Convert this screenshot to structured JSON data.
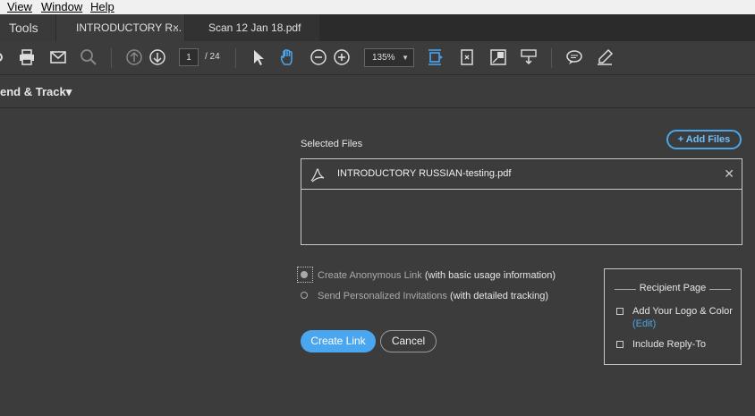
{
  "menubar": {
    "items": [
      "View",
      "Window",
      "Help"
    ]
  },
  "tabs": {
    "tools": "Tools",
    "active": "INTRODUCTORY R...",
    "close_symbol": "×",
    "second": "Scan 12 Jan 18.pdf"
  },
  "toolbar": {
    "page_current": "1",
    "page_total": "/ 24",
    "zoom": "135%",
    "icons": [
      "save-icon",
      "print-icon",
      "email-icon",
      "search-icon",
      "prev-page-icon",
      "next-page-icon",
      "select-cursor-icon",
      "hand-tool-icon",
      "zoom-out-icon",
      "zoom-in-icon",
      "fit-page-icon",
      "rotate-icon",
      "full-screen-icon",
      "scroll-mode-icon",
      "comment-icon",
      "highlight-icon"
    ]
  },
  "section": {
    "title": "end & Track",
    "caret": "▾"
  },
  "files": {
    "label": "Selected Files",
    "add_button": "+ Add Files",
    "items": [
      "INTRODUCTORY RUSSIAN-testing.pdf"
    ],
    "close_symbol": "✕"
  },
  "options": {
    "anonymous": {
      "label": "Create Anonymous Link",
      "hint": "(with basic usage information)",
      "selected": true
    },
    "personalized": {
      "label": "Send Personalized Invitations",
      "hint": "(with detailed tracking)",
      "selected": false
    }
  },
  "buttons": {
    "create": "Create Link",
    "cancel": "Cancel"
  },
  "recipient": {
    "title": "Recipient Page",
    "logo_color": "Add Your Logo & Color",
    "edit": "(Edit)",
    "reply_to": "Include Reply-To"
  },
  "colors": {
    "accent": "#4aa6ef",
    "background": "#3c3c3c",
    "link": "#4aa6e8"
  }
}
